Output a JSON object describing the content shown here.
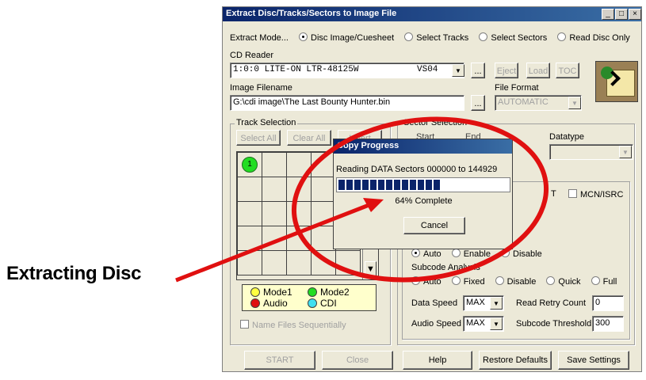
{
  "window": {
    "title": "Extract Disc/Tracks/Sectors to Image File",
    "min_btn": "_",
    "max_btn": "□",
    "close_btn": "×"
  },
  "mode": {
    "label": "Extract Mode...",
    "options": [
      {
        "label": "Disc Image/Cuesheet",
        "selected": true
      },
      {
        "label": "Select Tracks",
        "selected": false
      },
      {
        "label": "Select Sectors",
        "selected": false
      },
      {
        "label": "Read Disc Only",
        "selected": false
      }
    ]
  },
  "cd_reader": {
    "label": "CD Reader",
    "device": "1:0:0 LITE-ON  LTR-48125W",
    "firmware": "VS04",
    "browse": "...",
    "eject": "Eject",
    "load": "Load",
    "toc": "TOC"
  },
  "image_filename": {
    "label": "Image Filename",
    "value": "G:\\cdi image\\The Last Bounty Hunter.bin",
    "browse": "..."
  },
  "file_format": {
    "label": "File Format",
    "value": "AUTOMATIC"
  },
  "track_selection": {
    "label": "Track Selection",
    "select_all": "Select All",
    "clear_all": "Clear All",
    "invert": "Invert",
    "track1": "1"
  },
  "legend": {
    "mode1": "Mode1",
    "mode2": "Mode2",
    "audio": "Audio",
    "cdi": "CDI"
  },
  "name_files": "Name Files Sequentially",
  "sector_selection": {
    "label": "Sector Selection",
    "start": "Start",
    "end": "End",
    "datatype": "Datatype"
  },
  "mcn_isrc": "MCN/ISRC",
  "partial_label": "T",
  "row_auto": {
    "auto": "Auto",
    "enable": "Enable",
    "disable": "Disable"
  },
  "subcode": {
    "label": "Subcode Analysis",
    "auto": "Auto",
    "fixed": "Fixed",
    "disable": "Disable",
    "quick": "Quick",
    "full": "Full"
  },
  "data_speed": {
    "label": "Data Speed",
    "value": "MAX"
  },
  "audio_speed": {
    "label": "Audio Speed",
    "value": "MAX"
  },
  "read_retry": {
    "label": "Read Retry Count",
    "value": "0"
  },
  "subcode_threshold": {
    "label": "Subcode Threshold",
    "value": "300"
  },
  "buttons": {
    "start": "START",
    "close": "Close",
    "help": "Help",
    "restore": "Restore Defaults",
    "save": "Save Settings"
  },
  "progress_dialog": {
    "title": "Copy Progress",
    "status": "Reading DATA Sectors 000000 to 144929",
    "percent": 64,
    "percent_label": "64% Complete",
    "cancel": "Cancel"
  },
  "callout": {
    "text": "Extracting Disc",
    "color": "#e01010"
  }
}
